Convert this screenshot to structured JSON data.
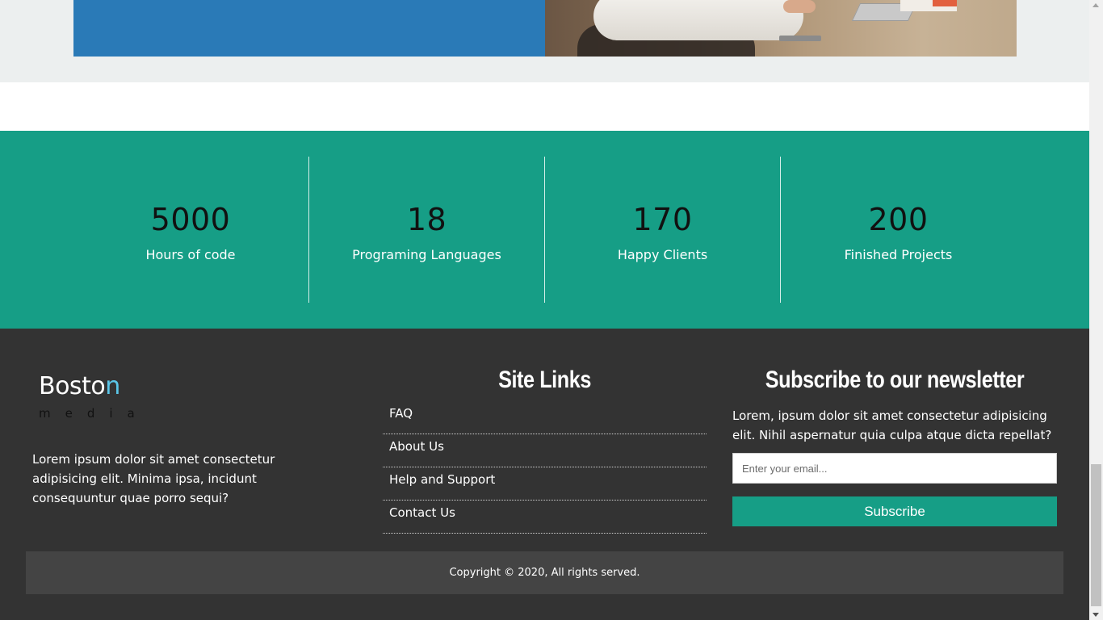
{
  "stats": [
    {
      "number": "5000",
      "label": "Hours of code"
    },
    {
      "number": "18",
      "label": "Programing Languages"
    },
    {
      "number": "170",
      "label": "Happy Clients"
    },
    {
      "number": "200",
      "label": "Finished Projects"
    }
  ],
  "footer": {
    "brand": {
      "name_main": "Bosto",
      "name_accent": "n",
      "sub": "media"
    },
    "about": "Lorem ipsum dolor sit amet consectetur adipisicing elit. Minima ipsa, incidunt consequuntur quae porro sequi?",
    "site_links": {
      "title": "Site Links",
      "items": [
        "FAQ",
        "About Us",
        "Help and Support",
        "Contact Us"
      ]
    },
    "newsletter": {
      "title": "Subscribe to our newsletter",
      "text": "Lorem, ipsum dolor sit amet consectetur adipisicing elit. Nihil aspernatur quia culpa atque dicta repellat?",
      "email_placeholder": "Enter your email...",
      "email_value": "",
      "button_label": "Subscribe"
    },
    "copyright": "Copyright © 2020, All rights served."
  },
  "colors": {
    "accent_teal": "#169e86",
    "hero_blue": "#2a7ab7",
    "brand_accent": "#5bc6e8",
    "footer_bg": "#333333"
  }
}
